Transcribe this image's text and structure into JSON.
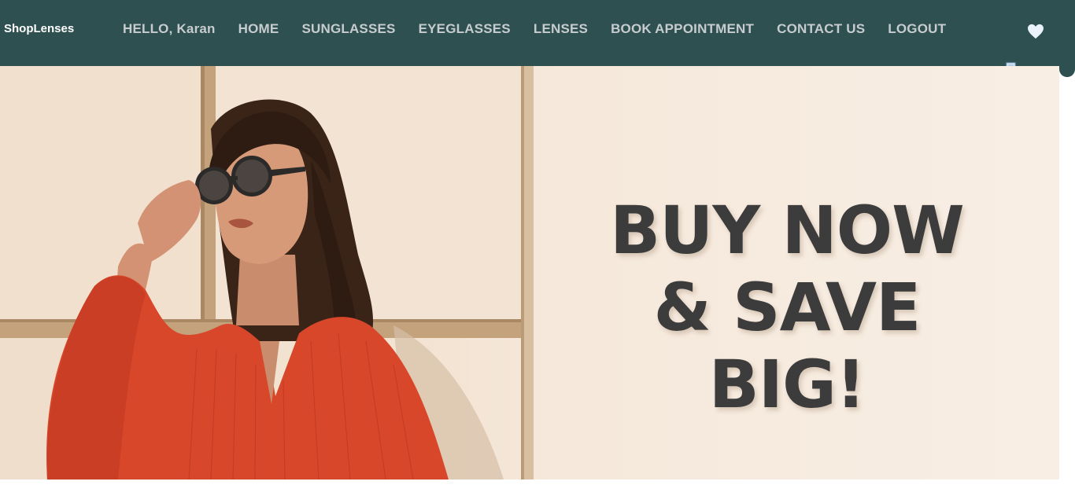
{
  "navbar": {
    "brand": "ShopLenses",
    "greeting": "HELLO, Karan",
    "links": [
      "HOME",
      "SUNGLASSES",
      "EYEGLASSES",
      "LENSES",
      "BOOK APPOINTMENT",
      "CONTACT US",
      "LOGOUT"
    ],
    "background_color": "#2f5050",
    "icons": [
      "heart-icon",
      "cart-icon"
    ]
  },
  "hero": {
    "headline_line1": "BUY NOW",
    "headline_line2": "& SAVE BIG!",
    "text_color": "#3c3c3c",
    "accent_dress_color": "#d9472b"
  }
}
